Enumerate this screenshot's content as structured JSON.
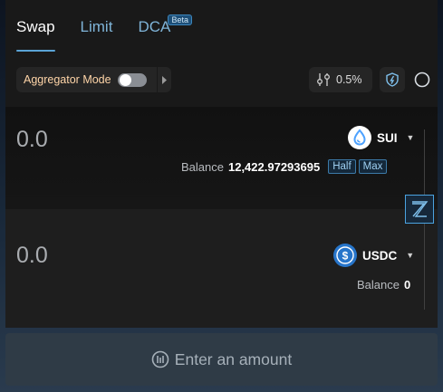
{
  "tabs": [
    {
      "label": "Swap",
      "active": true
    },
    {
      "label": "Limit",
      "active": false
    },
    {
      "label": "DCA",
      "active": false,
      "badge": "Beta"
    }
  ],
  "toolbar": {
    "aggregator_label": "Aggregator Mode",
    "aggregator_enabled": false,
    "slippage": "0.5%"
  },
  "from": {
    "amount": "0.0",
    "token": "SUI",
    "balance_label": "Balance",
    "balance_value": "12,422.97293695",
    "half_label": "Half",
    "max_label": "Max"
  },
  "to": {
    "amount": "0.0",
    "token": "USDC",
    "balance_label": "Balance",
    "balance_value": "0"
  },
  "cta": {
    "label": "Enter an amount"
  },
  "colors": {
    "accent": "#5aa3d6",
    "panel": "#191919",
    "sui": "#4da2ff",
    "usdc": "#2775ca"
  }
}
